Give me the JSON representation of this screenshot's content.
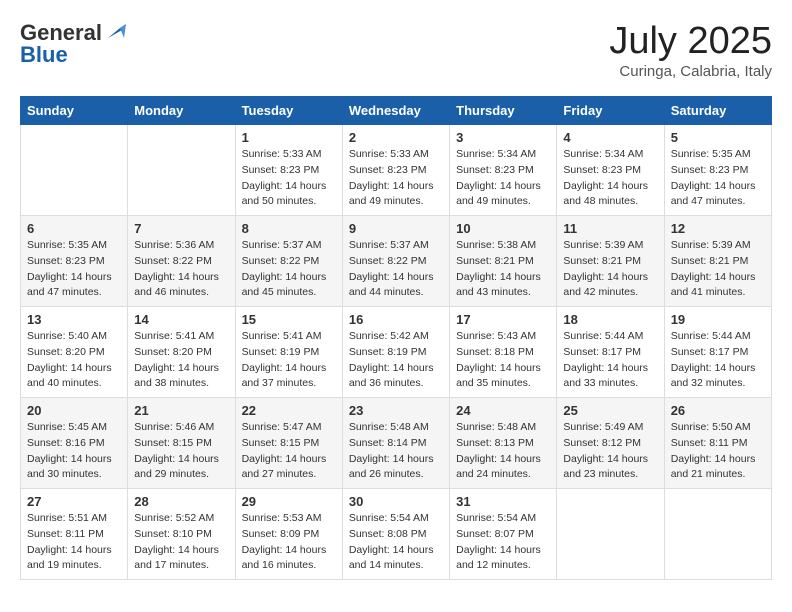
{
  "header": {
    "logo": {
      "line1": "General",
      "line2": "Blue"
    },
    "title": "July 2025",
    "subtitle": "Curinga, Calabria, Italy"
  },
  "weekdays": [
    "Sunday",
    "Monday",
    "Tuesday",
    "Wednesday",
    "Thursday",
    "Friday",
    "Saturday"
  ],
  "weeks": [
    [
      {
        "day": null
      },
      {
        "day": null
      },
      {
        "day": 1,
        "sunrise": "5:33 AM",
        "sunset": "8:23 PM",
        "daylight": "14 hours and 50 minutes."
      },
      {
        "day": 2,
        "sunrise": "5:33 AM",
        "sunset": "8:23 PM",
        "daylight": "14 hours and 49 minutes."
      },
      {
        "day": 3,
        "sunrise": "5:34 AM",
        "sunset": "8:23 PM",
        "daylight": "14 hours and 49 minutes."
      },
      {
        "day": 4,
        "sunrise": "5:34 AM",
        "sunset": "8:23 PM",
        "daylight": "14 hours and 48 minutes."
      },
      {
        "day": 5,
        "sunrise": "5:35 AM",
        "sunset": "8:23 PM",
        "daylight": "14 hours and 47 minutes."
      }
    ],
    [
      {
        "day": 6,
        "sunrise": "5:35 AM",
        "sunset": "8:23 PM",
        "daylight": "14 hours and 47 minutes."
      },
      {
        "day": 7,
        "sunrise": "5:36 AM",
        "sunset": "8:22 PM",
        "daylight": "14 hours and 46 minutes."
      },
      {
        "day": 8,
        "sunrise": "5:37 AM",
        "sunset": "8:22 PM",
        "daylight": "14 hours and 45 minutes."
      },
      {
        "day": 9,
        "sunrise": "5:37 AM",
        "sunset": "8:22 PM",
        "daylight": "14 hours and 44 minutes."
      },
      {
        "day": 10,
        "sunrise": "5:38 AM",
        "sunset": "8:21 PM",
        "daylight": "14 hours and 43 minutes."
      },
      {
        "day": 11,
        "sunrise": "5:39 AM",
        "sunset": "8:21 PM",
        "daylight": "14 hours and 42 minutes."
      },
      {
        "day": 12,
        "sunrise": "5:39 AM",
        "sunset": "8:21 PM",
        "daylight": "14 hours and 41 minutes."
      }
    ],
    [
      {
        "day": 13,
        "sunrise": "5:40 AM",
        "sunset": "8:20 PM",
        "daylight": "14 hours and 40 minutes."
      },
      {
        "day": 14,
        "sunrise": "5:41 AM",
        "sunset": "8:20 PM",
        "daylight": "14 hours and 38 minutes."
      },
      {
        "day": 15,
        "sunrise": "5:41 AM",
        "sunset": "8:19 PM",
        "daylight": "14 hours and 37 minutes."
      },
      {
        "day": 16,
        "sunrise": "5:42 AM",
        "sunset": "8:19 PM",
        "daylight": "14 hours and 36 minutes."
      },
      {
        "day": 17,
        "sunrise": "5:43 AM",
        "sunset": "8:18 PM",
        "daylight": "14 hours and 35 minutes."
      },
      {
        "day": 18,
        "sunrise": "5:44 AM",
        "sunset": "8:17 PM",
        "daylight": "14 hours and 33 minutes."
      },
      {
        "day": 19,
        "sunrise": "5:44 AM",
        "sunset": "8:17 PM",
        "daylight": "14 hours and 32 minutes."
      }
    ],
    [
      {
        "day": 20,
        "sunrise": "5:45 AM",
        "sunset": "8:16 PM",
        "daylight": "14 hours and 30 minutes."
      },
      {
        "day": 21,
        "sunrise": "5:46 AM",
        "sunset": "8:15 PM",
        "daylight": "14 hours and 29 minutes."
      },
      {
        "day": 22,
        "sunrise": "5:47 AM",
        "sunset": "8:15 PM",
        "daylight": "14 hours and 27 minutes."
      },
      {
        "day": 23,
        "sunrise": "5:48 AM",
        "sunset": "8:14 PM",
        "daylight": "14 hours and 26 minutes."
      },
      {
        "day": 24,
        "sunrise": "5:48 AM",
        "sunset": "8:13 PM",
        "daylight": "14 hours and 24 minutes."
      },
      {
        "day": 25,
        "sunrise": "5:49 AM",
        "sunset": "8:12 PM",
        "daylight": "14 hours and 23 minutes."
      },
      {
        "day": 26,
        "sunrise": "5:50 AM",
        "sunset": "8:11 PM",
        "daylight": "14 hours and 21 minutes."
      }
    ],
    [
      {
        "day": 27,
        "sunrise": "5:51 AM",
        "sunset": "8:11 PM",
        "daylight": "14 hours and 19 minutes."
      },
      {
        "day": 28,
        "sunrise": "5:52 AM",
        "sunset": "8:10 PM",
        "daylight": "14 hours and 17 minutes."
      },
      {
        "day": 29,
        "sunrise": "5:53 AM",
        "sunset": "8:09 PM",
        "daylight": "14 hours and 16 minutes."
      },
      {
        "day": 30,
        "sunrise": "5:54 AM",
        "sunset": "8:08 PM",
        "daylight": "14 hours and 14 minutes."
      },
      {
        "day": 31,
        "sunrise": "5:54 AM",
        "sunset": "8:07 PM",
        "daylight": "14 hours and 12 minutes."
      },
      {
        "day": null
      },
      {
        "day": null
      }
    ]
  ]
}
